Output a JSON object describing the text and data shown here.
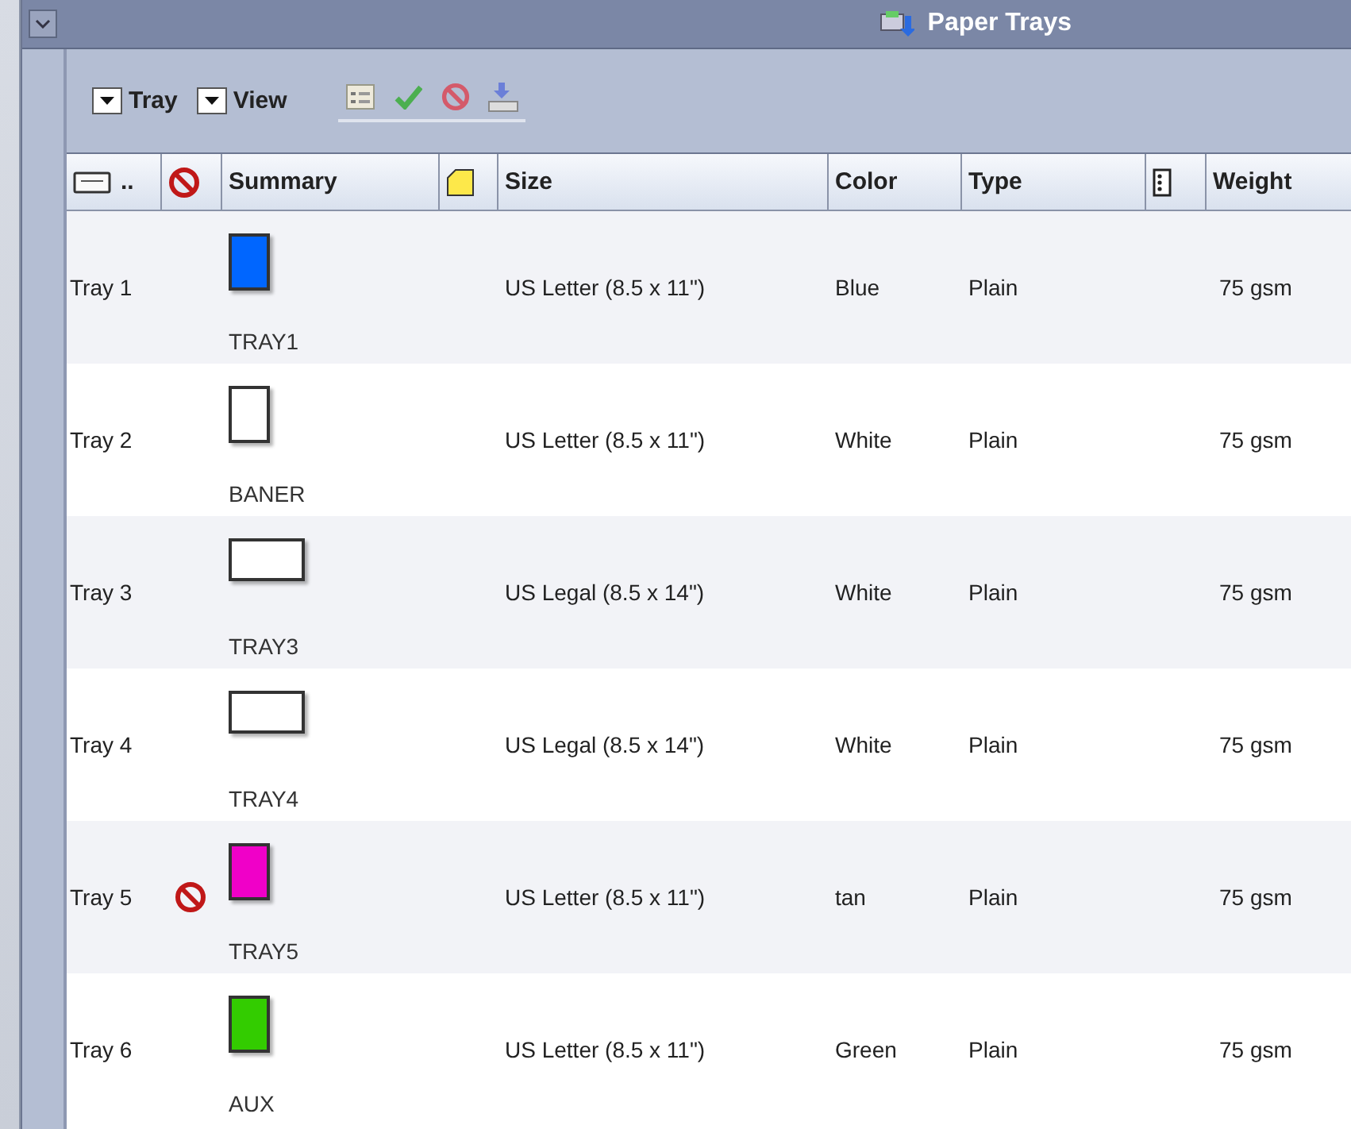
{
  "window": {
    "title": "Paper Trays"
  },
  "menus": [
    {
      "label": "Tray"
    },
    {
      "label": "View"
    }
  ],
  "table": {
    "columns": [
      "..",
      "Summary",
      "Size",
      "Color",
      "Type",
      "Weight"
    ],
    "rows": [
      {
        "name": "Tray 1",
        "disabled": false,
        "paper": {
          "kind": "portrait",
          "color": "#0066ff",
          "label": "TRAY1"
        },
        "size": "US Letter (8.5 x 11\")",
        "color_name": "Blue",
        "type": "Plain",
        "weight": "75 gsm"
      },
      {
        "name": "Tray 2",
        "disabled": false,
        "paper": {
          "kind": "portrait",
          "color": "#ffffff",
          "label": "BANER"
        },
        "size": "US Letter (8.5 x 11\")",
        "color_name": "White",
        "type": "Plain",
        "weight": "75 gsm"
      },
      {
        "name": "Tray 3",
        "disabled": false,
        "paper": {
          "kind": "landscape",
          "color": "#ffffff",
          "label": "TRAY3"
        },
        "size": "US Legal (8.5 x 14\")",
        "color_name": "White",
        "type": "Plain",
        "weight": "75 gsm"
      },
      {
        "name": "Tray 4",
        "disabled": false,
        "paper": {
          "kind": "landscape",
          "color": "#ffffff",
          "label": "TRAY4"
        },
        "size": "US Legal (8.5 x 14\")",
        "color_name": "White",
        "type": "Plain",
        "weight": "75 gsm"
      },
      {
        "name": "Tray 5",
        "disabled": true,
        "paper": {
          "kind": "portrait",
          "color": "#f000c8",
          "label": "TRAY5"
        },
        "size": "US Letter (8.5 x 11\")",
        "color_name": "tan",
        "type": "Plain",
        "weight": "75 gsm"
      },
      {
        "name": "Tray 6",
        "disabled": false,
        "paper": {
          "kind": "portrait",
          "color": "#33cc00",
          "label": "AUX"
        },
        "size": "US Letter (8.5 x 11\")",
        "color_name": "Green",
        "type": "Plain",
        "weight": "75 gsm"
      }
    ]
  }
}
